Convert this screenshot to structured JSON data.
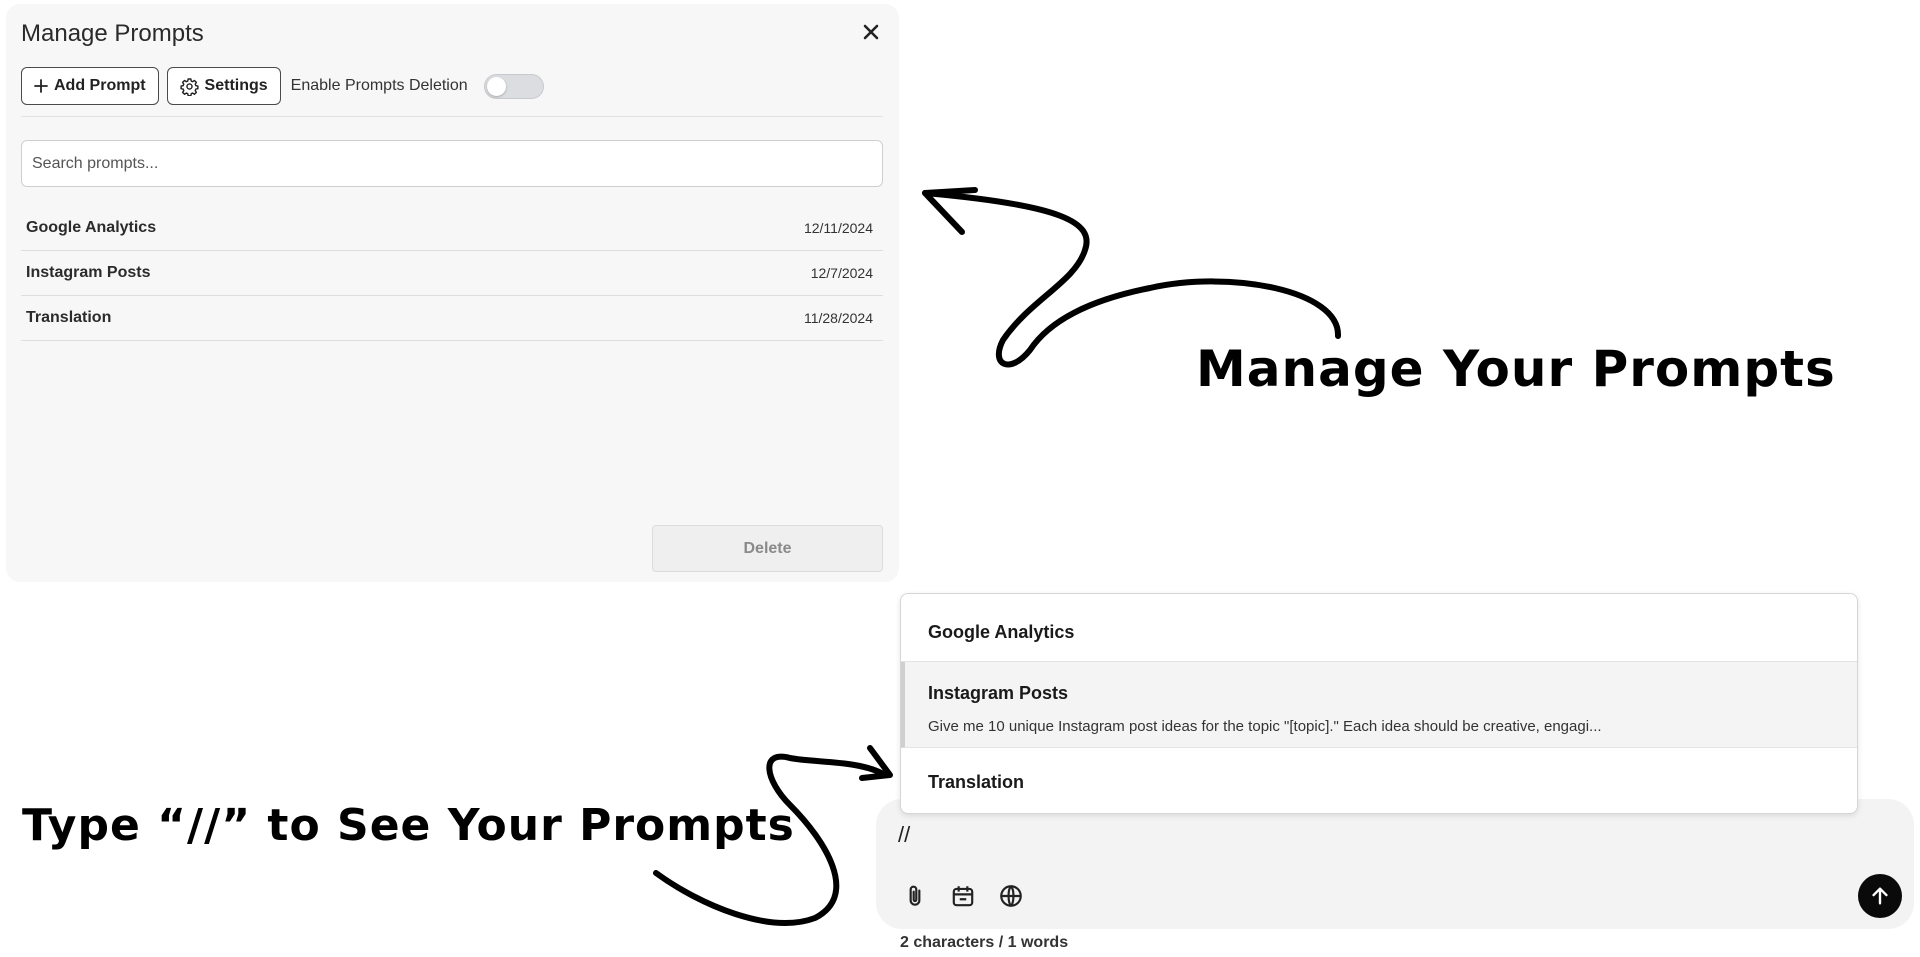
{
  "panel": {
    "title": "Manage Prompts",
    "add_prompt_label": "Add Prompt",
    "settings_label": "Settings",
    "toggle_label": "Enable Prompts Deletion",
    "toggle_on": false,
    "search_placeholder": "Search prompts...",
    "prompts": [
      {
        "name": "Google Analytics",
        "date": "12/11/2024"
      },
      {
        "name": "Instagram Posts",
        "date": "12/7/2024"
      },
      {
        "name": "Translation",
        "date": "11/28/2024"
      }
    ],
    "delete_label": "Delete"
  },
  "annotations": {
    "manage": "Manage Your Prompts",
    "type_hint": "Type “//” to See Your Prompts"
  },
  "dropdown": {
    "items": [
      {
        "title": "Google Analytics",
        "description": ""
      },
      {
        "title": "Instagram Posts",
        "description": "Give me 10 unique Instagram post ideas for the topic \"[topic].\" Each idea should be creative, engagi..."
      },
      {
        "title": "Translation",
        "description": ""
      }
    ]
  },
  "chat": {
    "input_value": "//",
    "counter": "2 characters / 1 words",
    "icons": [
      "paperclip-icon",
      "calendar-icon",
      "globe-icon",
      "arrow-up-icon"
    ]
  },
  "colors": {
    "panel_bg": "#f7f7f8",
    "send_button": "#0a0a0a",
    "annotation_ink": "#000000"
  }
}
